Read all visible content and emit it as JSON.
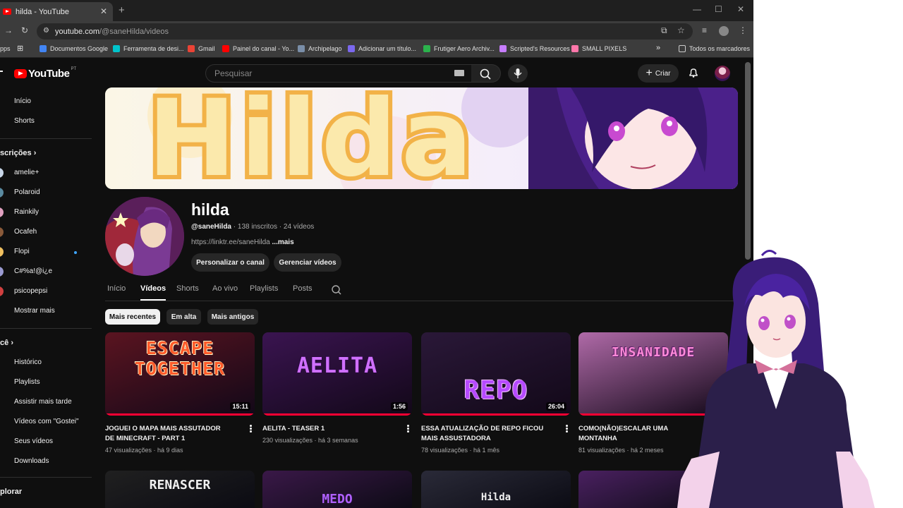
{
  "browser": {
    "tab_title": "hilda - YouTube",
    "url_host": "youtube.com",
    "url_path": "/@saneHilda/videos",
    "apps_label": "pps",
    "bookmarks": [
      {
        "label": "Documentos Google",
        "color": "#4285f4"
      },
      {
        "label": "Ferramenta de desi...",
        "color": "#00c4cc"
      },
      {
        "label": "Gmail",
        "color": "#ea4335"
      },
      {
        "label": "Painel do canal - Yo...",
        "color": "#ff0000"
      },
      {
        "label": "Archipelago",
        "color": "#7a8ea8"
      },
      {
        "label": "Adicionar um título...",
        "color": "#7b68ee"
      },
      {
        "label": "Frutiger Aero Archiv...",
        "color": "#2bb24c"
      },
      {
        "label": "Scripted's Resources",
        "color": "#c77dff"
      },
      {
        "label": "SMALL PIXELS",
        "color": "#ff77aa"
      }
    ],
    "all_bookmarks": "Todos os marcadores"
  },
  "masthead": {
    "logo": "YouTube",
    "logo_region": "PT",
    "search_placeholder": "Pesquisar",
    "create_label": "Criar"
  },
  "sidebar": {
    "top": [
      "Início",
      "Shorts"
    ],
    "subs_header": "scrições",
    "subscriptions": [
      {
        "name": "amelie+",
        "color": "#c8d6e8"
      },
      {
        "name": "Polaroid",
        "color": "#5a8aa0"
      },
      {
        "name": "Rainkily",
        "color": "#e0a0c0"
      },
      {
        "name": "Ocafeh",
        "color": "#8a5a3a"
      },
      {
        "name": "Flopi",
        "color": "#f0c060"
      },
      {
        "name": "C#%a!@i¿e",
        "color": "#9a9ad0"
      },
      {
        "name": "psicopepsi",
        "color": "#d04040"
      }
    ],
    "show_more": "Mostrar mais",
    "you_header": "cê",
    "you_items": [
      "Histórico",
      "Playlists",
      "Assistir mais tarde",
      "Vídeos com \"Gostei\"",
      "Seus vídeos",
      "Downloads"
    ],
    "explore_header": "plorar"
  },
  "channel": {
    "banner_text": "Hilda",
    "name": "hilda",
    "handle": "@saneHilda",
    "stats": " · 138 inscritos · 24 vídeos",
    "link": "https://linktr.ee/saneHilda",
    "more": "...mais",
    "customize_button": "Personalizar o canal",
    "manage_button": "Gerenciar vídeos"
  },
  "tabs": [
    "Início",
    "Vídeos",
    "Shorts",
    "Ao vivo",
    "Playlists",
    "Posts"
  ],
  "active_tab": "Vídeos",
  "chips": [
    "Mais recentes",
    "Em alta",
    "Mais antigos"
  ],
  "videos": [
    {
      "title": "JOGUEI O MAPA MAIS ASSUTADOR DE MINECRAFT - PART 1",
      "meta": "47 visualizações · há 9 dias",
      "duration": "15:11",
      "thumb_text": "ESCAPE TOGETHER",
      "bg": "#5a1420"
    },
    {
      "title": "AELITA - TEASER 1",
      "meta": "230 visualizações · há 3 semanas",
      "duration": "1:56",
      "thumb_text": "AELITA",
      "bg": "#3a1450"
    },
    {
      "title": "ESSA ATUALIZAÇÃO DE REPO FICOU MAIS ASSUSTADORA",
      "meta": "78 visualizações · há 1 mês",
      "duration": "26:04",
      "thumb_text": "REPO",
      "bg": "#2a1838"
    },
    {
      "title": "COMO(NÃO)ESCALAR UMA MONTANHA",
      "meta": "81 visualizações · há 2 meses",
      "duration": "",
      "thumb_text": "INSANIDADE",
      "bg": "#b06aa8"
    }
  ],
  "row2": [
    {
      "thumb_text": "RENASCER",
      "bg": "#202020"
    },
    {
      "thumb_text": "MEDO",
      "bg": "#3a1848"
    },
    {
      "thumb_text": "Hilda",
      "bg": "#2a2a38"
    },
    {
      "thumb_text": "",
      "bg": "#4a2060"
    }
  ]
}
